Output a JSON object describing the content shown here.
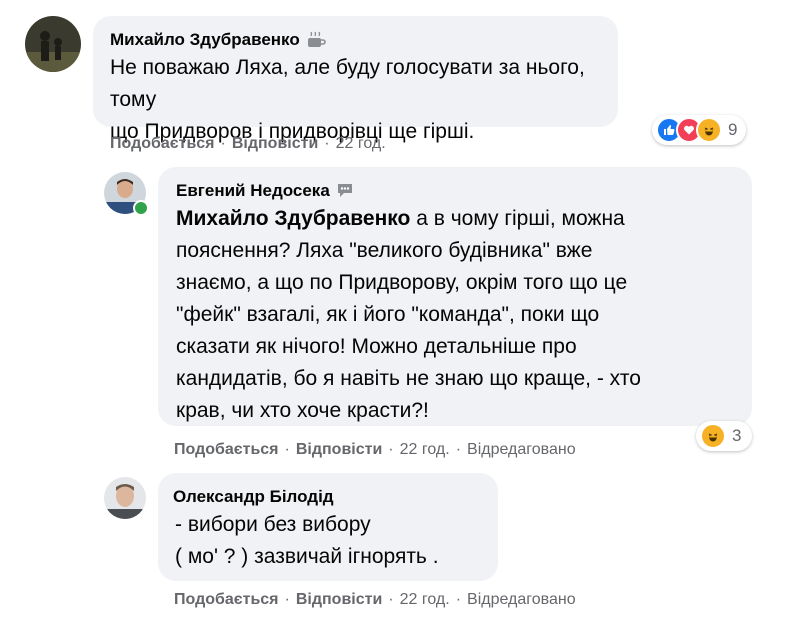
{
  "comments": [
    {
      "author": "Михайло Здубравенко",
      "text": "Не поважаю Ляха, але буду голосувати за нього, тому що Придворов і придворівці ще гірші.",
      "lines": [
        "Не поважаю Ляха, але буду голосувати за нього, тому",
        "що Придворов і придворівці ще гірші."
      ],
      "actions": {
        "like": "Подобається",
        "reply": "Відповісти",
        "time": "22 год."
      },
      "reaction_count": "9",
      "badge_icon": "coffee-cup-icon"
    },
    {
      "author": "Евгений Недосека",
      "mention": "Михайло Здубравенко",
      "lines": [
        " а в чому гірші, можна",
        "пояснення? Ляха \"великого будівника\" вже",
        "знаємо, а що по Придворову, окрім того що це",
        "\"фейк\" взагалі, як і його \"команда\", поки що",
        "сказати як нічого! Можно детальніше про",
        "кандидатів, бо я навіть не знаю що краще, - хто",
        "крав, чи хто хоче красти?!"
      ],
      "actions": {
        "like": "Подобається",
        "reply": "Відповісти",
        "time": "22 год.",
        "edited": "Відредаговано"
      },
      "reaction_count": "3",
      "badge_icon": "speech-bubble-icon"
    },
    {
      "author": "Олександр Білодід",
      "lines": [
        "- вибори без вибору",
        "( мо' ? ) зазвичай ігнорять ."
      ],
      "actions": {
        "like": "Подобається",
        "reply": "Відповісти",
        "time": "22 год.",
        "edited": "Відредаговано"
      }
    }
  ],
  "separator": "·",
  "colors": {
    "bubble": "#f0f2f5",
    "meta": "#65676b",
    "like_blue": "#1877f2",
    "love_red": "#f33e58",
    "haha_yellow": "#f7b125",
    "online": "#31a24c"
  }
}
